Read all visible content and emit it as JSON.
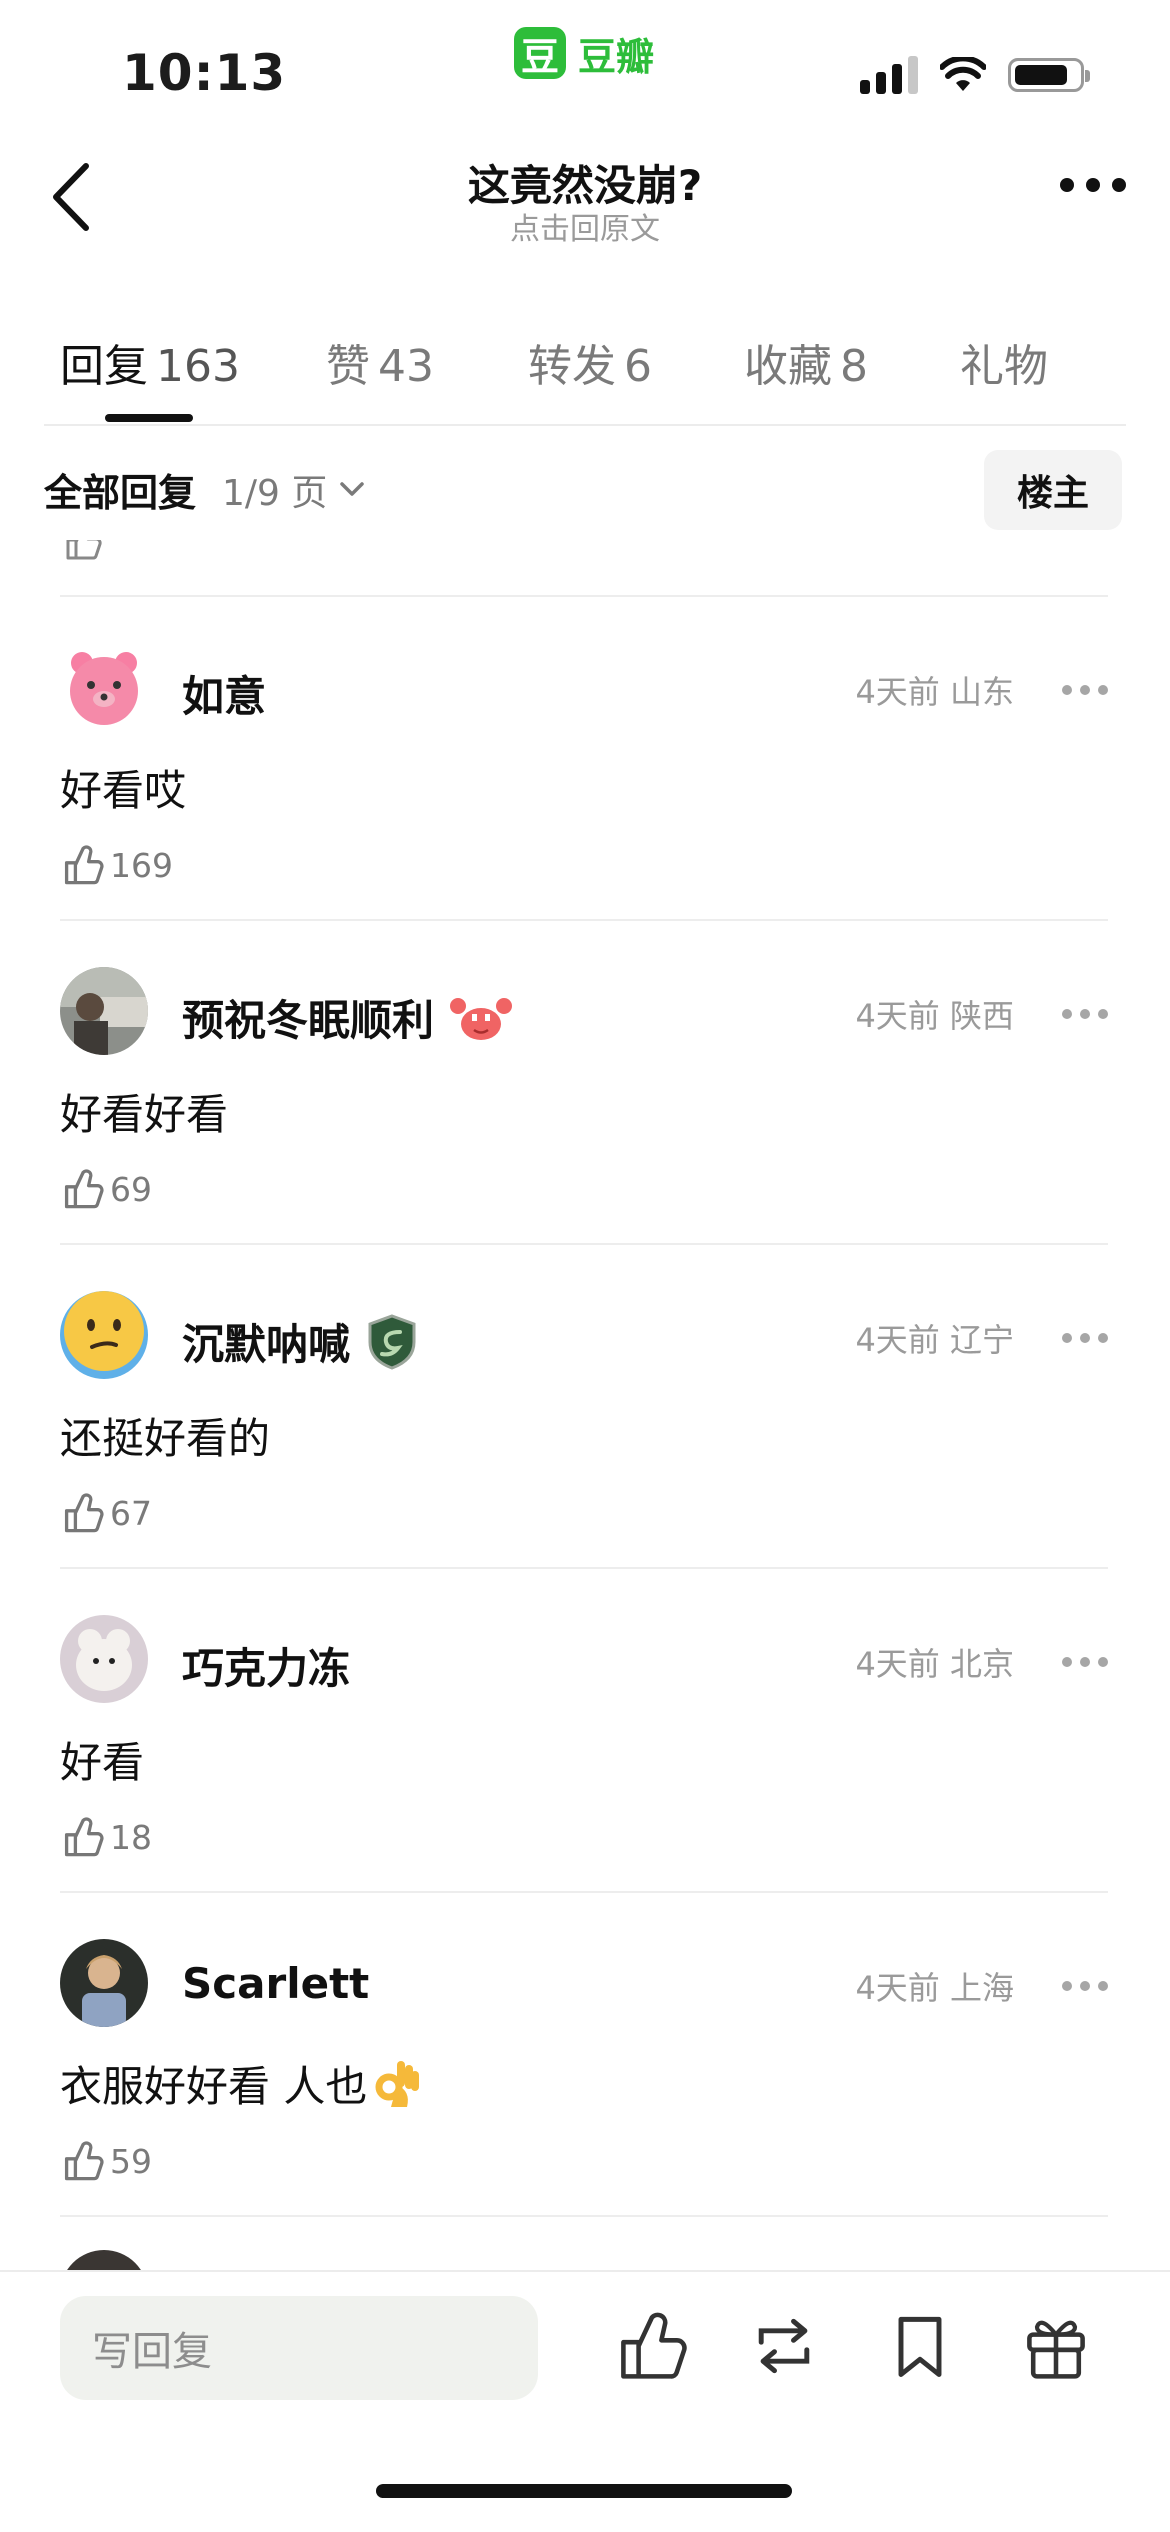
{
  "status_bar": {
    "time": "10:13",
    "app_logo_char": "豆",
    "app_name": "豆瓣",
    "icons": [
      "signal-icon",
      "wifi-icon",
      "battery-icon"
    ]
  },
  "nav": {
    "title": "这竟然没崩?",
    "subtitle": "点击回原文",
    "icons": [
      "back-icon",
      "more-icon"
    ]
  },
  "tabs": [
    {
      "label": "回复",
      "count": "163",
      "active": true
    },
    {
      "label": "赞",
      "count": "43",
      "active": false
    },
    {
      "label": "转发",
      "count": "6",
      "active": false
    },
    {
      "label": "收藏",
      "count": "8",
      "active": false
    },
    {
      "label": "礼物",
      "count": "",
      "active": false
    }
  ],
  "filter": {
    "all_label": "全部回复",
    "page_label": "1/9 页",
    "op_label": "楼主"
  },
  "comments": [
    {
      "name": "如意",
      "badge": "",
      "time": "4天前",
      "location": "山东",
      "text": "好看哎",
      "likes": "169",
      "avatar": "pink-bear-avatar"
    },
    {
      "name": "预祝冬眠顺利",
      "badge": "crab-badge-icon",
      "time": "4天前",
      "location": "陕西",
      "text": "好看好看",
      "likes": "69",
      "avatar": "photo-avatar"
    },
    {
      "name": "沉默呐喊",
      "badge": "snake-shield-badge-icon",
      "time": "4天前",
      "location": "辽宁",
      "text": "还挺好看的",
      "likes": "67",
      "avatar": "confused-face-avatar"
    },
    {
      "name": "巧克力冻",
      "badge": "",
      "time": "4天前",
      "location": "北京",
      "text": "好看",
      "likes": "18",
      "avatar": "plush-toy-avatar"
    },
    {
      "name": "Scarlett",
      "badge": "",
      "time": "4天前",
      "location": "上海",
      "text": "衣服好好看 人也",
      "text_emoji": "ok-hand-emoji",
      "likes": "59",
      "avatar": "portrait-avatar"
    }
  ],
  "bottom_bar": {
    "reply_placeholder": "写回复",
    "icons": [
      "like-icon",
      "repost-icon",
      "bookmark-icon",
      "gift-icon"
    ]
  },
  "colors": {
    "brand_green": "#2dbd3a",
    "text_primary": "#111111",
    "text_secondary": "#9a9a9a",
    "divider": "#ededed"
  }
}
